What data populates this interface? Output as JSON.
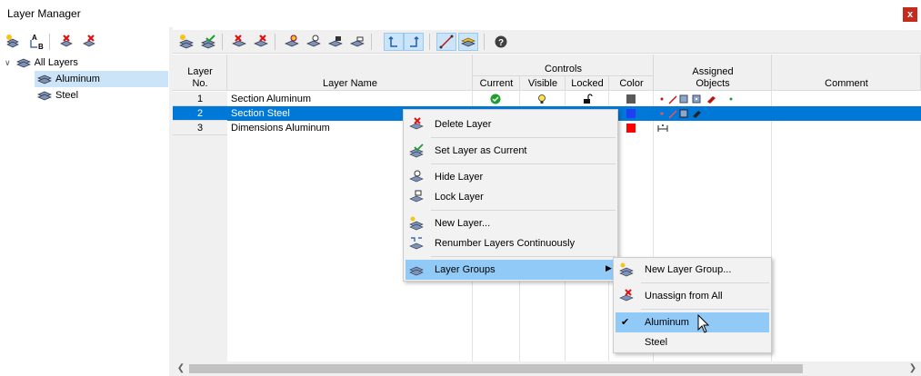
{
  "window": {
    "title": "Layer Manager",
    "close_label": "x"
  },
  "tree": {
    "root": {
      "label": "All Layers"
    },
    "children": [
      {
        "label": "Aluminum"
      },
      {
        "label": "Steel"
      }
    ]
  },
  "left_toolbar": {
    "sort_glyph_top": "A",
    "sort_glyph_bottom": "B",
    "buttons": [
      "new-group-icon",
      "sort-icon",
      "delete-icon",
      "delete-all-icon"
    ]
  },
  "right_toolbar": {
    "buttons": [
      "new-layer-icon",
      "set-current-icon",
      "delete-layer-icon",
      "delete-all-layers-icon",
      "show-layer-icon",
      "hide-layer-icon",
      "lock-layer-icon",
      "unlock-layer-icon",
      "undo-icon",
      "redo-icon",
      "assign-objects-icon",
      "layer-groups-icon",
      "help-icon"
    ]
  },
  "grid": {
    "headers": {
      "layer_no_1": "Layer",
      "layer_no_2": "No.",
      "layer_name": "Layer Name",
      "controls": "Controls",
      "current": "Current",
      "visible": "Visible",
      "locked": "Locked",
      "color": "Color",
      "assigned_1": "Assigned",
      "assigned_2": "Objects",
      "comment": "Comment"
    },
    "rows": [
      {
        "no": "1",
        "name": "Section Aluminum",
        "color": "#595959"
      },
      {
        "no": "2",
        "name": "Section Steel",
        "color": "#1f3ff5"
      },
      {
        "no": "3",
        "name": "Dimensions Aluminum",
        "color": "#ff0000"
      }
    ]
  },
  "context_menu": {
    "items": [
      {
        "label": "Delete Layer",
        "icon": "delete-layer-icon"
      },
      {
        "label": "Set Layer as Current",
        "icon": "set-current-icon"
      },
      {
        "label": "Hide Layer",
        "icon": "hide-layer-icon"
      },
      {
        "label": "Lock Layer",
        "icon": "lock-layer-icon"
      },
      {
        "label": "New Layer...",
        "icon": "new-layer-icon"
      },
      {
        "label": "Renumber Layers Continuously",
        "icon": "renumber-icon"
      },
      {
        "label": "Layer Groups",
        "icon": "layer-groups-icon"
      }
    ]
  },
  "submenu": {
    "items": [
      {
        "label": "New Layer Group...",
        "icon": "new-group-icon"
      },
      {
        "label": "Unassign from All",
        "icon": "unassign-icon"
      },
      {
        "label": "Aluminum",
        "checked": true
      },
      {
        "label": "Steel",
        "checked": false
      }
    ]
  },
  "colors": {
    "selection": "#0078d7",
    "menu_highlight": "#91c9f7",
    "tree_selection": "#cce4f7",
    "close_button": "#c42b1c"
  }
}
